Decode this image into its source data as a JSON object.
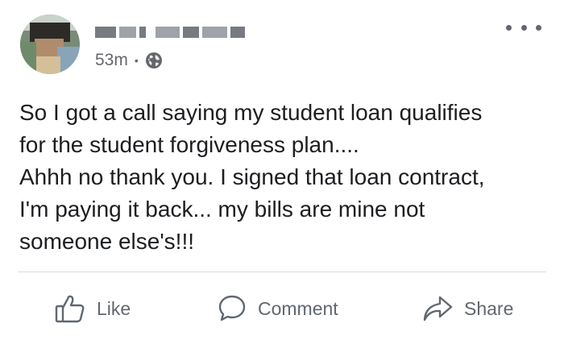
{
  "post": {
    "author_name": "[blurred name]",
    "timestamp": "53m",
    "separator": "•",
    "visibility_icon": "globe-icon",
    "menu_icon": "more-options-icon",
    "body_lines": [
      "So I got a call saying my student loan qualifies",
      "for the student forgiveness plan....",
      "Ahhh no thank you. I signed that loan contract,",
      "I'm paying it back... my bills are mine not",
      "someone else's!!!"
    ]
  },
  "actions": {
    "like": {
      "label": "Like",
      "icon": "thumbs-up-icon"
    },
    "comment": {
      "label": "Comment",
      "icon": "comment-bubble-icon"
    },
    "share": {
      "label": "Share",
      "icon": "share-arrow-icon"
    }
  },
  "colors": {
    "text": "#1c1e21",
    "secondary_text": "#65676b",
    "icon": "#606770",
    "divider": "#dadde1",
    "background": "#ffffff"
  }
}
